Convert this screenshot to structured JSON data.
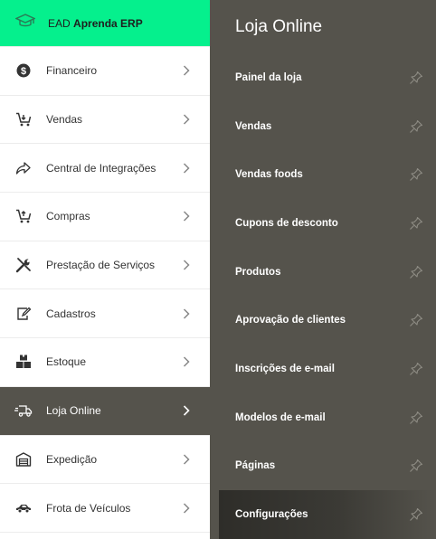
{
  "sidebar": {
    "ead": {
      "prefix": "EAD",
      "name": "Aprenda ERP",
      "icon": "graduation-cap-icon",
      "color": "#05f08d"
    },
    "items": [
      {
        "label": "Financeiro",
        "icon": "dollar-circle-icon"
      },
      {
        "label": "Vendas",
        "icon": "cart-icon"
      },
      {
        "label": "Central de Integrações",
        "icon": "share-arrow-icon"
      },
      {
        "label": "Compras",
        "icon": "cart-icon"
      },
      {
        "label": "Prestação de Serviços",
        "icon": "tools-icon"
      },
      {
        "label": "Cadastros",
        "icon": "edit-icon"
      },
      {
        "label": "Estoque",
        "icon": "boxes-icon"
      },
      {
        "label": "Loja Online",
        "icon": "delivery-truck-icon",
        "active": true
      },
      {
        "label": "Expedição",
        "icon": "warehouse-icon"
      },
      {
        "label": "Frota de Veículos",
        "icon": "car-icon"
      }
    ]
  },
  "panel": {
    "title": "Loja Online",
    "items": [
      {
        "label": "Painel da loja"
      },
      {
        "label": "Vendas"
      },
      {
        "label": "Vendas foods"
      },
      {
        "label": "Cupons de desconto"
      },
      {
        "label": "Produtos"
      },
      {
        "label": "Aprovação de clientes"
      },
      {
        "label": "Inscrições de e-mail"
      },
      {
        "label": "Modelos de e-mail"
      },
      {
        "label": "Páginas"
      },
      {
        "label": "Configurações",
        "selected": true
      }
    ],
    "background": "#55534c"
  }
}
